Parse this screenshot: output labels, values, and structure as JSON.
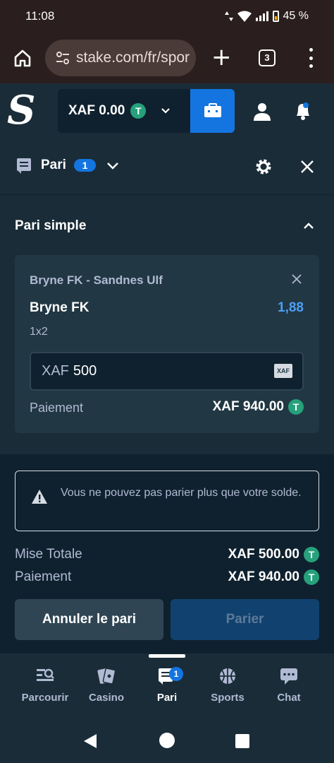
{
  "status_bar": {
    "time": "11:08",
    "battery": "45 %"
  },
  "browser": {
    "url": "stake.com/fr/spor",
    "tab_count": "3"
  },
  "header": {
    "logo": "S",
    "balance": "XAF 0.00",
    "currency_icon": "T"
  },
  "betslip": {
    "title": "Pari",
    "count": "1"
  },
  "section": {
    "title": "Pari simple"
  },
  "bet": {
    "match": "Bryne FK - Sandnes Ulf",
    "selection": "Bryne FK",
    "odds": "1,88",
    "market": "1x2",
    "stake_currency": "XAF",
    "stake_value": "500",
    "currency_badge": "XAF",
    "payout_label": "Paiement",
    "payout_value": "XAF 940.00"
  },
  "warning": {
    "text": "Vous ne pouvez pas parier plus que votre solde."
  },
  "summary": {
    "total_label": "Mise Totale",
    "total_value": "XAF 500.00",
    "payout_label": "Paiement",
    "payout_value": "XAF 940.00"
  },
  "actions": {
    "cancel": "Annuler le pari",
    "place": "Parier"
  },
  "bottom_nav": {
    "items": [
      {
        "label": "Parcourir",
        "icon": "browse-icon"
      },
      {
        "label": "Casino",
        "icon": "cards-icon"
      },
      {
        "label": "Pari",
        "icon": "betslip-icon"
      },
      {
        "label": "Sports",
        "icon": "basketball-icon"
      },
      {
        "label": "Chat",
        "icon": "chat-icon"
      }
    ],
    "badge": "1"
  },
  "colors": {
    "background": "#1a2c38",
    "panel": "#0f212e",
    "card": "#213743",
    "accent": "#1475e1",
    "odds": "#4d9ff5",
    "tether": "#26a17b"
  }
}
